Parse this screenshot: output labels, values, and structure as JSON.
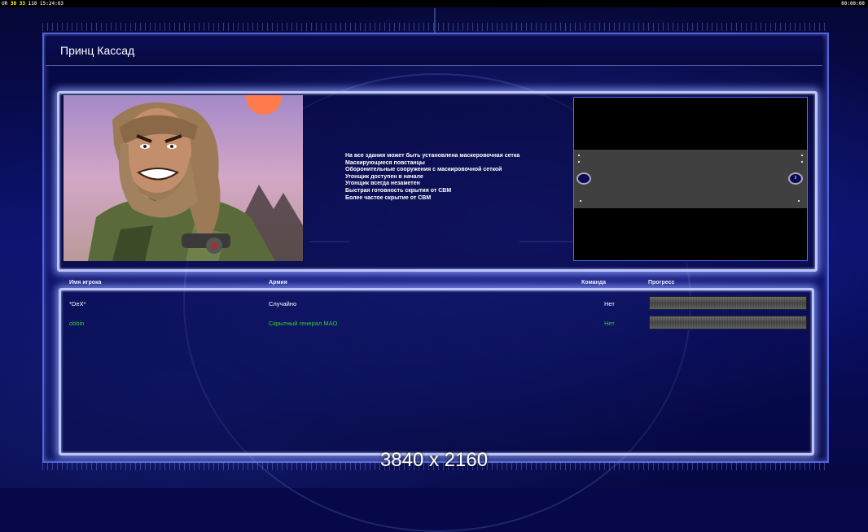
{
  "hud": {
    "left_prefix": "UR",
    "left_a": "30",
    "left_b": "33",
    "left_c": "110",
    "clock": "15:24:03",
    "timer": "00:00:00"
  },
  "general": {
    "name": "Принц Кассад",
    "features": [
      "На все здания может быть установлена маскеровочная сетка",
      "Маскирующиеся повстанцы",
      "Оборонительные сооружения с маскировочной сеткой",
      "Угонщик доступен в начале",
      "Угонщик всегда незаметен",
      "Быстрая готовность скрытия от СВМ",
      "Более частое скрытие от СВМ"
    ]
  },
  "minimap": {
    "slot_left": "",
    "slot_right": "2"
  },
  "players_table": {
    "headers": {
      "name": "Имя игрока",
      "army": "Армия",
      "team": "Команда",
      "progress": "Прогресс"
    },
    "rows": [
      {
        "name": "*DeX*",
        "army": "Случайно",
        "team": "Нет",
        "progress": 0,
        "color": "#ffffff"
      },
      {
        "name": "obbin",
        "army": "Скрытный генерал МАО",
        "team": "Нет",
        "progress": 0,
        "color": "#33cc33"
      }
    ]
  },
  "overlay": {
    "resolution": "3840 x 2160"
  }
}
